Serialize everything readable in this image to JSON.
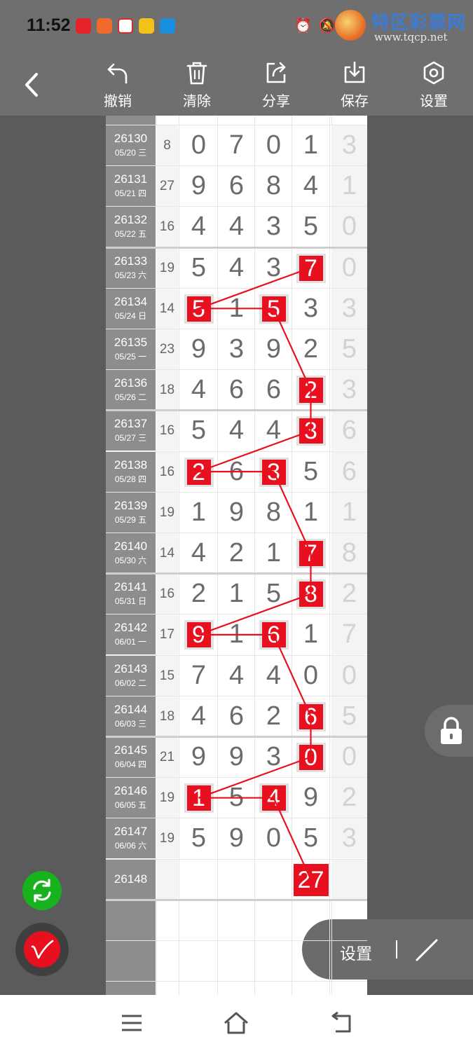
{
  "status_bar": {
    "time": "11:52",
    "watermark_title": "特区彩票网",
    "watermark_url": "www.tqcp.net"
  },
  "toolbar": {
    "undo_label": "撤销",
    "clear_label": "清除",
    "share_label": "分享",
    "save_label": "保存",
    "settings_label": "设置"
  },
  "table": {
    "rows": [
      {
        "period": "26130",
        "date": "05/20 三",
        "sum": "8",
        "digits": [
          "0",
          "7",
          "0",
          "1"
        ],
        "tail": "3"
      },
      {
        "period": "26131",
        "date": "05/21 四",
        "sum": "27",
        "digits": [
          "9",
          "6",
          "8",
          "4"
        ],
        "tail": "1"
      },
      {
        "period": "26132",
        "date": "05/22 五",
        "sum": "16",
        "digits": [
          "4",
          "4",
          "3",
          "5"
        ],
        "tail": "0"
      },
      {
        "period": "26133",
        "date": "05/23 六",
        "sum": "19",
        "digits": [
          "5",
          "4",
          "3",
          "7"
        ],
        "tail": "0"
      },
      {
        "period": "26134",
        "date": "05/24 日",
        "sum": "14",
        "digits": [
          "5",
          "1",
          "5",
          "3"
        ],
        "tail": "3"
      },
      {
        "period": "26135",
        "date": "05/25 一",
        "sum": "23",
        "digits": [
          "9",
          "3",
          "9",
          "2"
        ],
        "tail": "5"
      },
      {
        "period": "26136",
        "date": "05/26 二",
        "sum": "18",
        "digits": [
          "4",
          "6",
          "6",
          "2"
        ],
        "tail": "3"
      },
      {
        "period": "26137",
        "date": "05/27 三",
        "sum": "16",
        "digits": [
          "5",
          "4",
          "4",
          "3"
        ],
        "tail": "6"
      },
      {
        "period": "26138",
        "date": "05/28 四",
        "sum": "16",
        "digits": [
          "2",
          "6",
          "3",
          "5"
        ],
        "tail": "6"
      },
      {
        "period": "26139",
        "date": "05/29 五",
        "sum": "19",
        "digits": [
          "1",
          "9",
          "8",
          "1"
        ],
        "tail": "1"
      },
      {
        "period": "26140",
        "date": "05/30 六",
        "sum": "14",
        "digits": [
          "4",
          "2",
          "1",
          "7"
        ],
        "tail": "8"
      },
      {
        "period": "26141",
        "date": "05/31 日",
        "sum": "16",
        "digits": [
          "2",
          "1",
          "5",
          "8"
        ],
        "tail": "2"
      },
      {
        "period": "26142",
        "date": "06/01 一",
        "sum": "17",
        "digits": [
          "9",
          "1",
          "6",
          "1"
        ],
        "tail": "7"
      },
      {
        "period": "26143",
        "date": "06/02 二",
        "sum": "15",
        "digits": [
          "7",
          "4",
          "4",
          "0"
        ],
        "tail": "0"
      },
      {
        "period": "26144",
        "date": "06/03 三",
        "sum": "18",
        "digits": [
          "4",
          "6",
          "2",
          "6"
        ],
        "tail": "5"
      },
      {
        "period": "26145",
        "date": "06/04 四",
        "sum": "21",
        "digits": [
          "9",
          "9",
          "3",
          "0"
        ],
        "tail": "0"
      },
      {
        "period": "26146",
        "date": "06/05 五",
        "sum": "19",
        "digits": [
          "1",
          "5",
          "4",
          "9"
        ],
        "tail": "2"
      },
      {
        "period": "26147",
        "date": "06/06 六",
        "sum": "19",
        "digits": [
          "5",
          "9",
          "0",
          "5"
        ],
        "tail": "3"
      },
      {
        "period": "26148",
        "date": "",
        "sum": "",
        "digits": [
          "",
          "",
          "",
          ""
        ],
        "tail": "",
        "highlight_value": "27"
      }
    ],
    "highlights": [
      {
        "row": 3,
        "col": 3
      },
      {
        "row": 4,
        "col": 0
      },
      {
        "row": 4,
        "col": 2
      },
      {
        "row": 6,
        "col": 3
      },
      {
        "row": 7,
        "col": 3
      },
      {
        "row": 8,
        "col": 0
      },
      {
        "row": 8,
        "col": 2
      },
      {
        "row": 10,
        "col": 3
      },
      {
        "row": 11,
        "col": 3
      },
      {
        "row": 12,
        "col": 0
      },
      {
        "row": 12,
        "col": 2
      },
      {
        "row": 14,
        "col": 3
      },
      {
        "row": 15,
        "col": 3
      },
      {
        "row": 16,
        "col": 0
      },
      {
        "row": 16,
        "col": 2
      },
      {
        "row": 18,
        "col": 3
      }
    ],
    "accent_color": "#e8101e"
  },
  "floating": {
    "settings_label": "设置"
  },
  "icons": [
    "back-icon",
    "undo-icon",
    "trash-icon",
    "share-icon",
    "download-icon",
    "hexagon-settings-icon",
    "lock-icon",
    "sync-icon",
    "pen-icon",
    "draw-line-icon",
    "menu-icon",
    "home-icon",
    "back-nav-icon"
  ]
}
